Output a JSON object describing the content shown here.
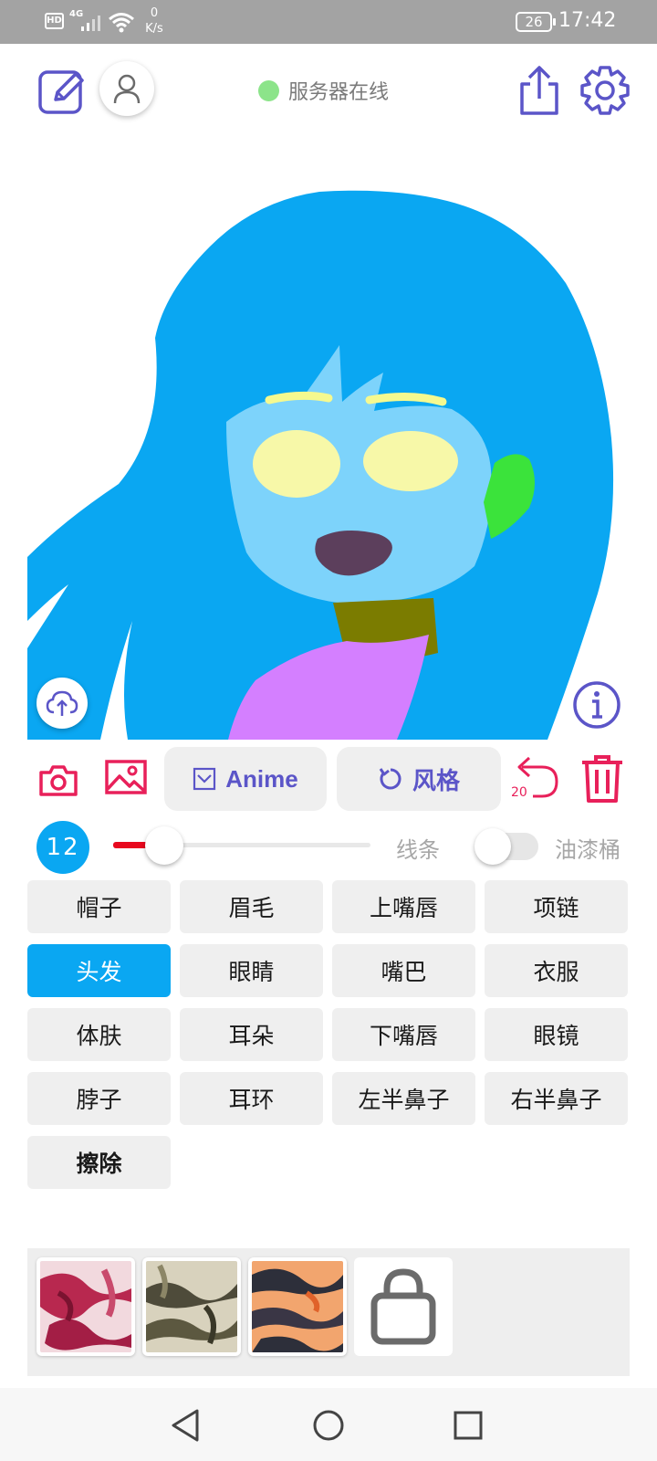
{
  "status_bar": {
    "hd": "HD",
    "network": "4G",
    "speed_value": "0",
    "speed_unit": "K/s",
    "battery": "26",
    "time": "17:42"
  },
  "header": {
    "server_status": "服务器在线",
    "status_color": "#8ce48a",
    "accent_color": "#5b55c8"
  },
  "toolbar": {
    "anime_label": "Anime",
    "style_label": "风格",
    "undo_count": "20",
    "danger_color": "#e8205a"
  },
  "brush": {
    "size": "12",
    "slider_fraction": 0.2,
    "line_label": "线条",
    "bucket_label": "油漆桶",
    "bucket_on": false
  },
  "parts": [
    {
      "label": "帽子"
    },
    {
      "label": "眉毛"
    },
    {
      "label": "上嘴唇"
    },
    {
      "label": "项链"
    },
    {
      "label": "头发",
      "active": true
    },
    {
      "label": "眼睛"
    },
    {
      "label": "嘴巴"
    },
    {
      "label": "衣服"
    },
    {
      "label": "体肤"
    },
    {
      "label": "耳朵"
    },
    {
      "label": "下嘴唇"
    },
    {
      "label": "眼镜"
    },
    {
      "label": "脖子"
    },
    {
      "label": "耳环"
    },
    {
      "label": "左半鼻子"
    },
    {
      "label": "右半鼻子"
    },
    {
      "label": "擦除",
      "bold": true
    }
  ],
  "active_color": "#0aa7f2",
  "style_thumbnails": [
    {
      "name": "style-thumbnail-red"
    },
    {
      "name": "style-thumbnail-olive"
    },
    {
      "name": "style-thumbnail-orange"
    },
    {
      "name": "style-store-bag",
      "icon": "shopping-bag-icon"
    }
  ]
}
